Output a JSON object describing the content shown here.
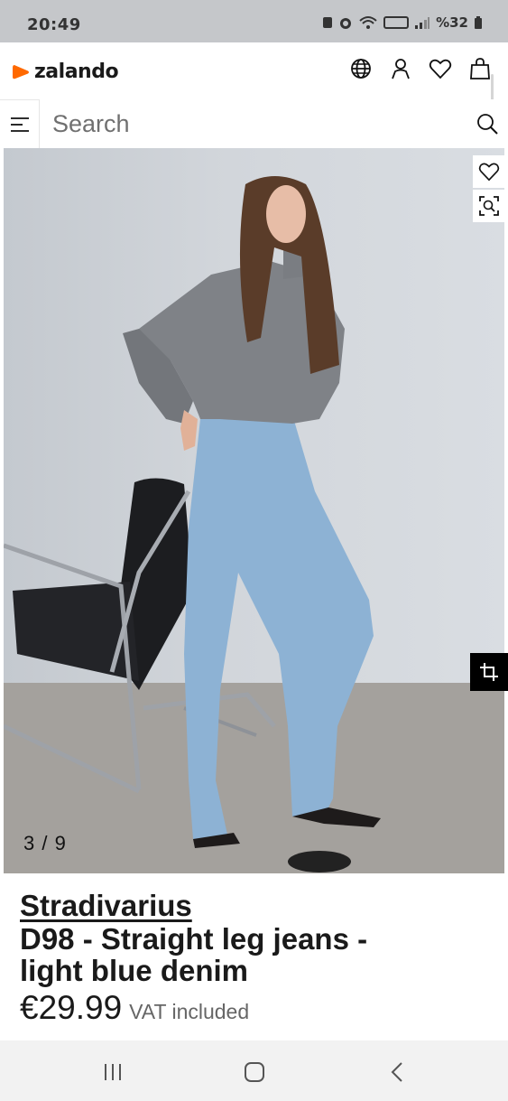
{
  "status_bar": {
    "time": "20:49",
    "battery": "%32"
  },
  "header": {
    "logo_text": "zalando",
    "brand_color": "#ff6900"
  },
  "search": {
    "placeholder": "Search"
  },
  "gallery": {
    "counter": "3 / 9"
  },
  "product": {
    "brand": "Stradivarius",
    "title_line1": "D98 - Straight leg jeans -",
    "title_line2": "light blue denim",
    "price": "€29.99",
    "vat_note": "VAT included"
  },
  "icons": {
    "header": [
      "globe-icon",
      "user-icon",
      "heart-icon",
      "bag-icon"
    ],
    "side": [
      "wishlist-icon",
      "zoom-icon",
      "crop-icon"
    ],
    "nav": [
      "recents-icon",
      "home-icon",
      "back-icon"
    ]
  }
}
